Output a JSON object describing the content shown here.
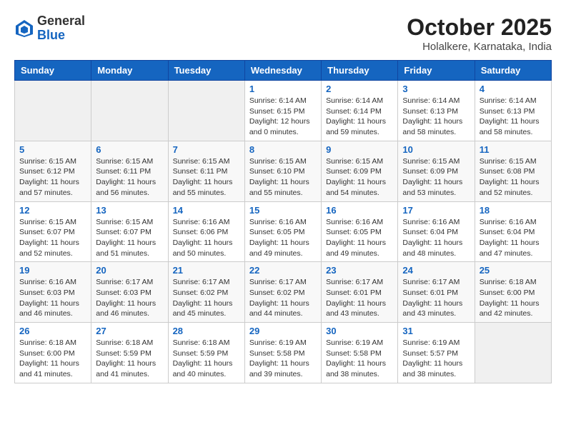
{
  "header": {
    "logo_general": "General",
    "logo_blue": "Blue",
    "month": "October 2025",
    "location": "Holalkere, Karnataka, India"
  },
  "days_of_week": [
    "Sunday",
    "Monday",
    "Tuesday",
    "Wednesday",
    "Thursday",
    "Friday",
    "Saturday"
  ],
  "weeks": [
    [
      {
        "day": "",
        "info": ""
      },
      {
        "day": "",
        "info": ""
      },
      {
        "day": "",
        "info": ""
      },
      {
        "day": "1",
        "info": "Sunrise: 6:14 AM\nSunset: 6:15 PM\nDaylight: 12 hours\nand 0 minutes."
      },
      {
        "day": "2",
        "info": "Sunrise: 6:14 AM\nSunset: 6:14 PM\nDaylight: 11 hours\nand 59 minutes."
      },
      {
        "day": "3",
        "info": "Sunrise: 6:14 AM\nSunset: 6:13 PM\nDaylight: 11 hours\nand 58 minutes."
      },
      {
        "day": "4",
        "info": "Sunrise: 6:14 AM\nSunset: 6:13 PM\nDaylight: 11 hours\nand 58 minutes."
      }
    ],
    [
      {
        "day": "5",
        "info": "Sunrise: 6:15 AM\nSunset: 6:12 PM\nDaylight: 11 hours\nand 57 minutes."
      },
      {
        "day": "6",
        "info": "Sunrise: 6:15 AM\nSunset: 6:11 PM\nDaylight: 11 hours\nand 56 minutes."
      },
      {
        "day": "7",
        "info": "Sunrise: 6:15 AM\nSunset: 6:11 PM\nDaylight: 11 hours\nand 55 minutes."
      },
      {
        "day": "8",
        "info": "Sunrise: 6:15 AM\nSunset: 6:10 PM\nDaylight: 11 hours\nand 55 minutes."
      },
      {
        "day": "9",
        "info": "Sunrise: 6:15 AM\nSunset: 6:09 PM\nDaylight: 11 hours\nand 54 minutes."
      },
      {
        "day": "10",
        "info": "Sunrise: 6:15 AM\nSunset: 6:09 PM\nDaylight: 11 hours\nand 53 minutes."
      },
      {
        "day": "11",
        "info": "Sunrise: 6:15 AM\nSunset: 6:08 PM\nDaylight: 11 hours\nand 52 minutes."
      }
    ],
    [
      {
        "day": "12",
        "info": "Sunrise: 6:15 AM\nSunset: 6:07 PM\nDaylight: 11 hours\nand 52 minutes."
      },
      {
        "day": "13",
        "info": "Sunrise: 6:15 AM\nSunset: 6:07 PM\nDaylight: 11 hours\nand 51 minutes."
      },
      {
        "day": "14",
        "info": "Sunrise: 6:16 AM\nSunset: 6:06 PM\nDaylight: 11 hours\nand 50 minutes."
      },
      {
        "day": "15",
        "info": "Sunrise: 6:16 AM\nSunset: 6:05 PM\nDaylight: 11 hours\nand 49 minutes."
      },
      {
        "day": "16",
        "info": "Sunrise: 6:16 AM\nSunset: 6:05 PM\nDaylight: 11 hours\nand 49 minutes."
      },
      {
        "day": "17",
        "info": "Sunrise: 6:16 AM\nSunset: 6:04 PM\nDaylight: 11 hours\nand 48 minutes."
      },
      {
        "day": "18",
        "info": "Sunrise: 6:16 AM\nSunset: 6:04 PM\nDaylight: 11 hours\nand 47 minutes."
      }
    ],
    [
      {
        "day": "19",
        "info": "Sunrise: 6:16 AM\nSunset: 6:03 PM\nDaylight: 11 hours\nand 46 minutes."
      },
      {
        "day": "20",
        "info": "Sunrise: 6:17 AM\nSunset: 6:03 PM\nDaylight: 11 hours\nand 46 minutes."
      },
      {
        "day": "21",
        "info": "Sunrise: 6:17 AM\nSunset: 6:02 PM\nDaylight: 11 hours\nand 45 minutes."
      },
      {
        "day": "22",
        "info": "Sunrise: 6:17 AM\nSunset: 6:02 PM\nDaylight: 11 hours\nand 44 minutes."
      },
      {
        "day": "23",
        "info": "Sunrise: 6:17 AM\nSunset: 6:01 PM\nDaylight: 11 hours\nand 43 minutes."
      },
      {
        "day": "24",
        "info": "Sunrise: 6:17 AM\nSunset: 6:01 PM\nDaylight: 11 hours\nand 43 minutes."
      },
      {
        "day": "25",
        "info": "Sunrise: 6:18 AM\nSunset: 6:00 PM\nDaylight: 11 hours\nand 42 minutes."
      }
    ],
    [
      {
        "day": "26",
        "info": "Sunrise: 6:18 AM\nSunset: 6:00 PM\nDaylight: 11 hours\nand 41 minutes."
      },
      {
        "day": "27",
        "info": "Sunrise: 6:18 AM\nSunset: 5:59 PM\nDaylight: 11 hours\nand 41 minutes."
      },
      {
        "day": "28",
        "info": "Sunrise: 6:18 AM\nSunset: 5:59 PM\nDaylight: 11 hours\nand 40 minutes."
      },
      {
        "day": "29",
        "info": "Sunrise: 6:19 AM\nSunset: 5:58 PM\nDaylight: 11 hours\nand 39 minutes."
      },
      {
        "day": "30",
        "info": "Sunrise: 6:19 AM\nSunset: 5:58 PM\nDaylight: 11 hours\nand 38 minutes."
      },
      {
        "day": "31",
        "info": "Sunrise: 6:19 AM\nSunset: 5:57 PM\nDaylight: 11 hours\nand 38 minutes."
      },
      {
        "day": "",
        "info": ""
      }
    ]
  ]
}
